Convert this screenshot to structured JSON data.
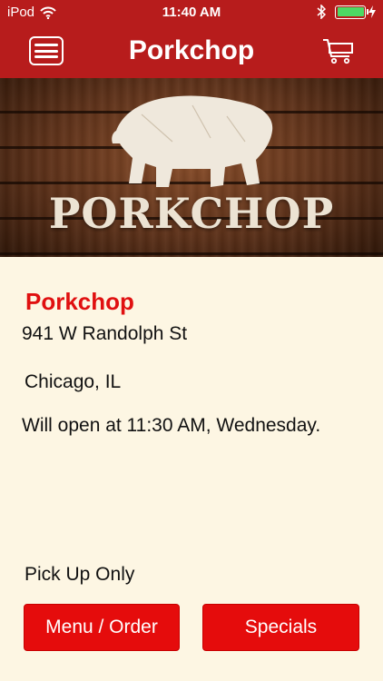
{
  "status_bar": {
    "carrier": "iPod",
    "time": "11:40 AM",
    "battery_color": "#4cd964"
  },
  "nav": {
    "title": "Porkchop",
    "left_icon": "hamburger-menu-icon",
    "right_icon": "shopping-cart-icon",
    "bg_color": "#b71c1c"
  },
  "banner": {
    "logo_text": "PORKCHOP"
  },
  "store": {
    "name": "Porkchop",
    "address": "941 W Randolph St",
    "city": "Chicago, IL",
    "hours_text": "Will open at 11:30 AM, Wednesday.",
    "pickup_text": "Pick Up Only"
  },
  "actions": {
    "menu_label": "Menu / Order",
    "specials_label": "Specials",
    "button_color": "#e50c0c"
  },
  "colors": {
    "accent": "#e01010",
    "background": "#fdf6e3"
  }
}
